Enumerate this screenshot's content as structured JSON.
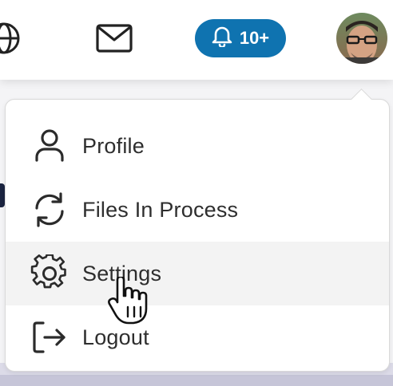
{
  "header": {
    "icons": [
      "globe-icon",
      "mail-icon",
      "bell-icon"
    ],
    "notifications_label": "10+",
    "notification_color": "#0f73b0"
  },
  "menu": {
    "items": [
      {
        "label": "Profile",
        "icon": "user-icon"
      },
      {
        "label": "Files In Process",
        "icon": "refresh-icon"
      },
      {
        "label": "Settings",
        "icon": "gear-icon",
        "state": "hovered"
      },
      {
        "label": "Logout",
        "icon": "logout-icon"
      }
    ]
  }
}
